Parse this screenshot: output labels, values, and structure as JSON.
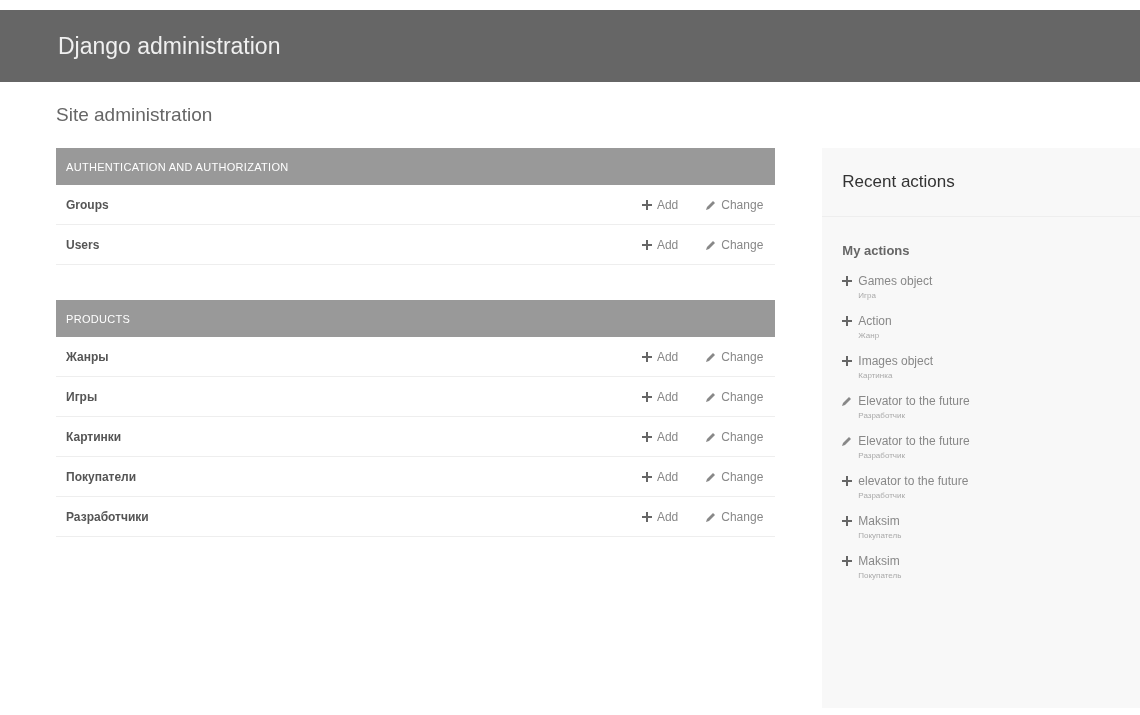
{
  "header": {
    "title": "Django administration"
  },
  "page_title": "Site administration",
  "modules": [
    {
      "caption": "AUTHENTICATION AND AUTHORIZATION",
      "models": [
        {
          "name": "Groups",
          "add": "Add",
          "change": "Change"
        },
        {
          "name": "Users",
          "add": "Add",
          "change": "Change"
        }
      ]
    },
    {
      "caption": "PRODUCTS",
      "models": [
        {
          "name": "Жанры",
          "add": "Add",
          "change": "Change"
        },
        {
          "name": "Игры",
          "add": "Add",
          "change": "Change"
        },
        {
          "name": "Картинки",
          "add": "Add",
          "change": "Change"
        },
        {
          "name": "Покупатели",
          "add": "Add",
          "change": "Change"
        },
        {
          "name": "Разработчики",
          "add": "Add",
          "change": "Change"
        }
      ]
    }
  ],
  "recent_actions": {
    "title": "Recent actions",
    "subtitle": "My actions",
    "items": [
      {
        "kind": "add",
        "label": "Games object",
        "type": "Игра"
      },
      {
        "kind": "add",
        "label": "Action",
        "type": "Жанр"
      },
      {
        "kind": "add",
        "label": "Images object",
        "type": "Картинка"
      },
      {
        "kind": "change",
        "label": "Elevator to the future",
        "type": "Разработчик"
      },
      {
        "kind": "change",
        "label": "Elevator to the future",
        "type": "Разработчик"
      },
      {
        "kind": "add",
        "label": "elevator to the future",
        "type": "Разработчик"
      },
      {
        "kind": "add",
        "label": "Maksim",
        "type": "Покупатель"
      },
      {
        "kind": "add",
        "label": "Maksim",
        "type": "Покупатель"
      }
    ]
  }
}
